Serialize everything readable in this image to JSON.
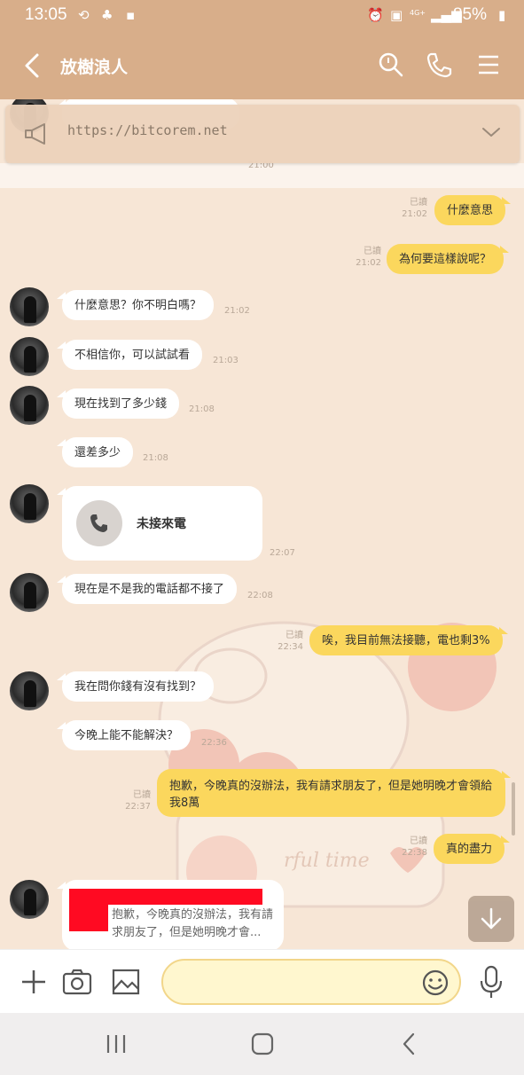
{
  "status_bar": {
    "time": "13:05",
    "battery": "85%",
    "network": "4G+"
  },
  "header": {
    "title": "放樹浪人"
  },
  "announcement": {
    "text": "https://bitcorem.net"
  },
  "messages": [
    {
      "id": "m0",
      "dir": "in",
      "time": "21:00"
    },
    {
      "id": "m1",
      "dir": "out",
      "text": "什麼意思",
      "read": "已讀",
      "time": "21:02"
    },
    {
      "id": "m2",
      "dir": "out",
      "text": "為何要這樣說呢？",
      "read": "已讀",
      "time": "21:02"
    },
    {
      "id": "m3",
      "dir": "in",
      "text": "什麼意思？你不明白嗎？",
      "time": "21:02"
    },
    {
      "id": "m4",
      "dir": "in",
      "text": "不相信你，可以試試看",
      "time": "21:03"
    },
    {
      "id": "m5",
      "dir": "in",
      "text": "現在找到了多少錢",
      "time": "21:08"
    },
    {
      "id": "m6",
      "dir": "in",
      "text": "還差多少",
      "time": "21:08"
    },
    {
      "id": "m7",
      "dir": "in",
      "type": "call",
      "text": "未接來電",
      "time": "22:07"
    },
    {
      "id": "m8",
      "dir": "in",
      "text": "現在是不是我的電話都不接了",
      "time": "22:08"
    },
    {
      "id": "m9",
      "dir": "out",
      "text": "唉，我目前無法接聽，電也剩3%",
      "read": "已讀",
      "time": "22:34"
    },
    {
      "id": "m10",
      "dir": "in",
      "text": "我在問你錢有沒有找到？",
      "time": ""
    },
    {
      "id": "m11",
      "dir": "in",
      "text": "今晚上能不能解決？",
      "time": "22:36"
    },
    {
      "id": "m12",
      "dir": "out",
      "text": "抱歉，今晚真的沒辦法，我有請求朋友了，但是她明晚才會領給我8萬",
      "read": "已讀",
      "time": "22:37"
    },
    {
      "id": "m13",
      "dir": "out",
      "text": "真的盡力",
      "read": "已讀",
      "time": "22:38"
    },
    {
      "id": "m14",
      "dir": "in",
      "type": "reply",
      "quote": "抱歉，今晚真的沒辦法，我有請求朋友了，但是她明晚才會..."
    }
  ],
  "background_text": "rful time",
  "input": {
    "placeholder": ""
  },
  "icons": {
    "back": "back-arrow-icon",
    "search": "search-icon",
    "call": "phone-icon",
    "menu": "menu-icon",
    "announce": "megaphone-icon",
    "expand": "chevron-down-icon",
    "add": "plus-icon",
    "camera": "camera-icon",
    "image": "image-icon",
    "emoji": "emoji-icon",
    "mic": "microphone-icon",
    "scroll_down": "arrow-down-icon"
  },
  "colors": {
    "header": "#d8ae8a",
    "chat_bg": "#f7e6d6",
    "out_bubble": "#fbd75d",
    "in_bubble": "#ffffff",
    "redaction": "#ff0a22"
  }
}
